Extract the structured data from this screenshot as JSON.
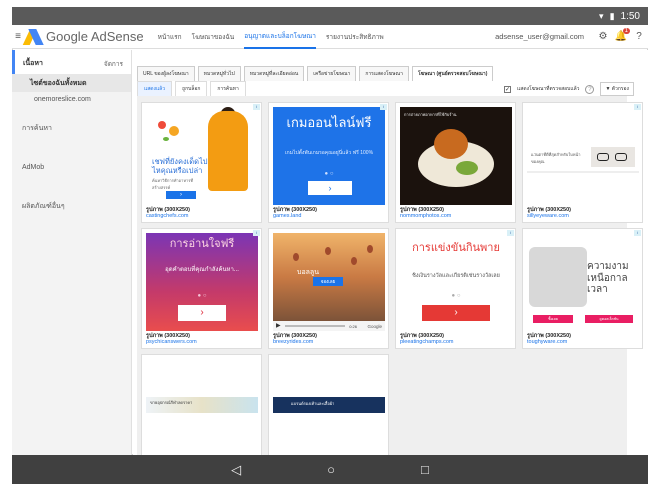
{
  "status": {
    "time": "1:50",
    "icons": [
      "wifi-icon",
      "battery-icon"
    ]
  },
  "header": {
    "logo_text": "Google AdSense",
    "nav": [
      "หน้าแรก",
      "โฆษณาของฉัน",
      "อนุญาตและบล็อกโฆษณา",
      "รายงานประสิทธิภาพ"
    ],
    "active_nav_index": 2,
    "user_email": "adsense_user@gmail.com",
    "notification_count": "1",
    "accent_color": "#1a73e8"
  },
  "sidebar": {
    "section_title": "เนื้อหา",
    "manage_label": "จัดการ",
    "selected_item": "ไซต์ของฉันทั้งหมด",
    "site": "onemoreslice.com",
    "items": [
      "การค้นหา",
      "AdMob",
      "ผลิตภัณฑ์อื่นๆ"
    ]
  },
  "tabs": [
    "URL ของผู้ลงโฆษณา",
    "หมวดหมู่ทั่วไป",
    "หมวดหมู่ที่ละเอียดอ่อน",
    "เครือข่ายโฆษณา",
    "การแสดงโฆษณา",
    "โฆษณา (ศูนย์ตรวจสอบโฆษณา)"
  ],
  "active_tab_index": 5,
  "subtabs": [
    "แสดงแล้ว",
    "ถูกบล็อก",
    "การค้นหา"
  ],
  "active_subtab_index": 0,
  "filter": {
    "checkbox_label": "แสดงโฆษณาที่ตรวจสอบแล้ว",
    "help": "?",
    "sort_label": "▼ ตัวกรอง"
  },
  "cards": [
    {
      "caption": "รูปภาพ (300X250)",
      "site": "castingchefs.com",
      "headline": "เชฟที่ยังคงเด็ดไปไหคุณหรือเปล่า",
      "sub": "ค้นหาวิธีการทำอาหารที่สร้างสรรค์",
      "button": ""
    },
    {
      "caption": "รูปภาพ (300X250)",
      "site": "games.land",
      "headline": "เกมออนไลน์ฟรี",
      "sub": "เกมไปตั้งพันเกมรอคุณอยู่นี่แล้ว ฟรี 100%",
      "button": "›"
    },
    {
      "caption": "รูปภาพ (300X250)",
      "site": "nommomphotos.com",
      "headline": "การถ่ายภาพอาหารที่ใช้กับร้าน",
      "sub": "",
      "button": ""
    },
    {
      "caption": "รูปภาพ (300X250)",
      "site": "sillyeyeware.com",
      "headline": "แว่นตาที่ดีที่สุดสำหรับใบหน้าของคุณ",
      "sub": "",
      "button": ""
    },
    {
      "caption": "รูปภาพ (300X250)",
      "site": "psychicanswers.com",
      "headline": "การอ่านใจฟรี",
      "sub": "อุดคำตอบที่คุณกำลังค้นหา...",
      "button": "›"
    },
    {
      "caption": "รูปภาพ (300X250)",
      "site": "breezyrides.com",
      "headline": "บอลลูน",
      "sub": "",
      "button": "จองเลย",
      "time": "0:26",
      "brand": "Google"
    },
    {
      "caption": "รูปภาพ (300X250)",
      "site": "pleeatingchamps.com",
      "headline": "การแข่งขันกินพาย",
      "sub": "ชิงเงินรางวัลและเกียรติเช่นรางวัลเลย",
      "button": "›"
    },
    {
      "caption": "รูปภาพ (300X250)",
      "site": "toughyware.com",
      "headline": "ความงามเหนือกาลเวลา",
      "sub": "",
      "button": "ซื้อเลย",
      "button2": "ดูคอลเล็กชัน"
    },
    {
      "caption": "",
      "site": "",
      "headline": "ขายอุปกรณ์กีฬาลดราคา",
      "sub": "",
      "button": ""
    },
    {
      "caption": "",
      "site": "",
      "headline": "แบรนด์รองเท้าและเสื้อผ้า",
      "sub": "",
      "button": ""
    }
  ],
  "android_nav": [
    "back-icon",
    "home-icon",
    "recents-icon"
  ]
}
